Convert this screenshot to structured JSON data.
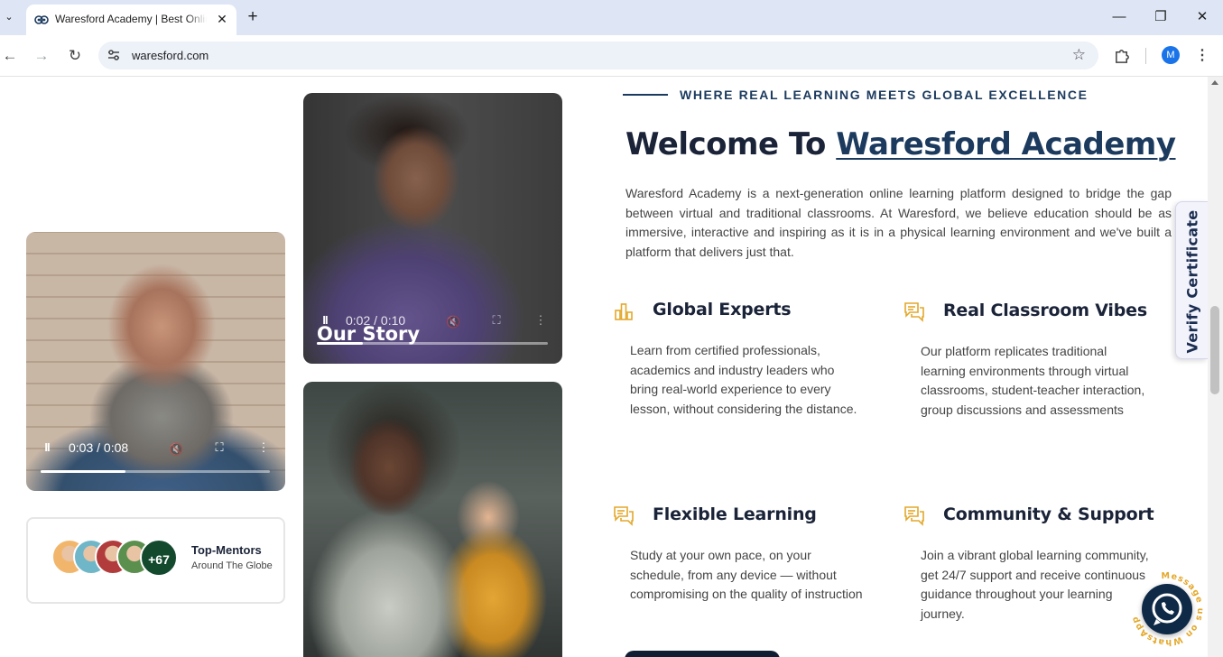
{
  "browser": {
    "tab_title": "Waresford Academy | Best Online",
    "url": "waresford.com",
    "profile_initial": "M",
    "glyphs": {
      "tab_list": "⌄",
      "close": "✕",
      "new_tab": "+",
      "minimize": "—",
      "restore": "❐",
      "win_close": "✕",
      "back": "←",
      "forward": "→",
      "reload": "↻",
      "star": "☆",
      "menu": "⋮"
    }
  },
  "videos": [
    {
      "time": "0:03 / 0:08",
      "progress": 0.37,
      "playing": true,
      "icons": [
        "pause-icon",
        "mute-icon",
        "fullscreen-icon",
        "more-icon"
      ]
    },
    {
      "time": "0:02 / 0:10",
      "progress": 0.2,
      "playing": true,
      "caption": "Our Story",
      "icons": [
        "pause-icon",
        "mute-icon",
        "fullscreen-icon",
        "more-icon"
      ]
    },
    {
      "caption": ""
    }
  ],
  "control_glyphs": {
    "pause": "II",
    "mute": "🔇",
    "fullscreen": "⛶",
    "more": "⋮"
  },
  "mentors": {
    "more_count": "+67",
    "title": "Top-Mentors",
    "subtitle": "Around The Globe",
    "avatar_colors": [
      "#f1b66c",
      "#6fb6c9",
      "#b23b3b",
      "#5a8f4e"
    ]
  },
  "about": {
    "tagline": "WHERE REAL LEARNING MEETS GLOBAL EXCELLENCE",
    "heading_prefix": "Welcome To",
    "heading_link": "Waresford Academy",
    "intro": "Waresford Academy is a next-generation online learning platform designed to bridge the gap between virtual and traditional classrooms. At Waresford, we believe education should be as immersive, interactive and inspiring as it is in a physical learning environment and we've built a platform that delivers just that."
  },
  "features": [
    {
      "title": "Global Experts",
      "icon": "bar-chart-icon",
      "text": "Learn from certified professionals, academics and industry leaders who bring real-world experience to every lesson, without considering the distance."
    },
    {
      "title": "Real Classroom Vibes",
      "icon": "chat-icon",
      "text": "Our platform replicates traditional learning environments through virtual classrooms, student-teacher interaction, group discussions and assessments"
    },
    {
      "title": "Flexible Learning",
      "icon": "chat-icon",
      "text": "Study at your own pace, on your schedule, from any device — without compromising on the quality of instruction"
    },
    {
      "title": "Community & Support",
      "icon": "chat-icon",
      "text": "Join a vibrant global learning community, get 24/7 support and receive continuous guidance throughout your learning journey."
    }
  ],
  "verify_tab": {
    "label": "Verify  Certificate"
  },
  "whatsapp": {
    "ring_text": "Message us on WhatsApp"
  },
  "colors": {
    "accent_gold": "#e3a82b",
    "navy": "#1b3a5e",
    "heading": "#1a2338",
    "mentor_badge": "#134a2e"
  }
}
